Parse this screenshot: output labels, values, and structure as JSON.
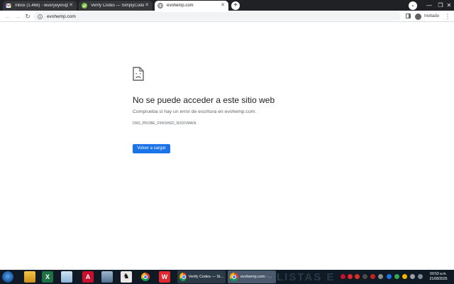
{
  "tabs": [
    {
      "title": "Inbox (1.468) - wueryeye5@gmail",
      "close": "✕",
      "active": false,
      "icon": "gmail-icon"
    },
    {
      "title": "Verify Codes — SimplyCodes",
      "close": "✕",
      "active": false,
      "icon": "simplycodes-icon"
    },
    {
      "title": "evohemp.com",
      "close": "✕",
      "active": true,
      "icon": "globe-icon"
    }
  ],
  "new_tab": "+",
  "window_controls": {
    "minimize": "—",
    "maximize": "❐",
    "close": "✕"
  },
  "toolbar": {
    "back": "←",
    "forward": "→",
    "reload": "↻",
    "url": "evohemp.com",
    "profile_label": "Invitado",
    "menu": "⋮"
  },
  "error_page": {
    "heading": "No se puede acceder a este sitio web",
    "suggestion": "Comprueba si hay un error de escritura en evohemp.com.",
    "error_code": "DNS_PROBE_FINISHED_NXDOMAIN",
    "reload_button": "Volver a cargar"
  },
  "taskbar": {
    "watermark": "LISTAS E",
    "tasks": [
      {
        "label": "Verify Codes — Si...",
        "icon": "chrome-icon"
      },
      {
        "label": "evohemp.com - ...",
        "icon": "chrome-icon"
      }
    ],
    "clock_time": "09:53 a.m.",
    "clock_date": "21/08/2025",
    "pinned": [
      "explorer-icon",
      "excel-icon",
      "notepad-icon",
      "acrobat-icon",
      "computer-icon",
      "game-icon",
      "chrome-icon",
      "wps-icon"
    ]
  },
  "colors": {
    "accent": "#1a73e8",
    "tabstrip": "#202124",
    "taskbar": "#101a24"
  }
}
